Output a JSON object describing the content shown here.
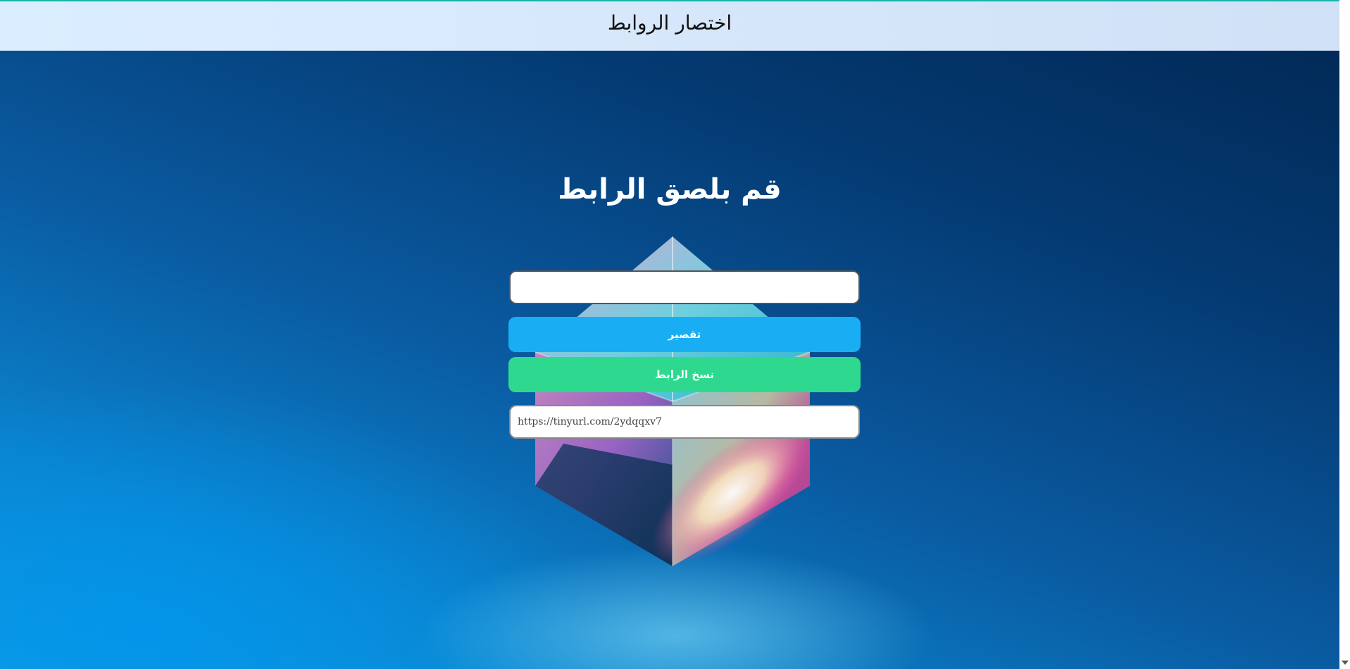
{
  "header": {
    "title": "اختصار الروابط"
  },
  "main": {
    "heading": "قم بلصق الرابط",
    "url_input": {
      "value": "",
      "placeholder": ""
    },
    "shorten_button_label": "تقصير",
    "copy_button_label": "نسخ الرابط",
    "result_input": {
      "value": "https://tinyurl.com/2ydqqxv7"
    }
  },
  "colors": {
    "header_bg": "#d6e8fb",
    "header_border": "#18b3a8",
    "shorten_button": "#19aef4",
    "copy_button": "#2ed98f",
    "background_dark": "#022a58",
    "background_light": "#0f9be0"
  }
}
